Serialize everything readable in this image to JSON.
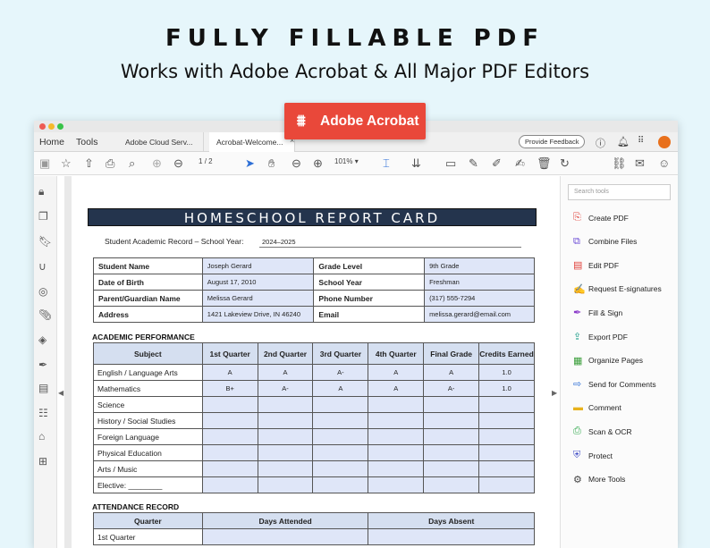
{
  "headline": "FULLY FILLABLE PDF",
  "subheadline": "Works with Adobe Acrobat & All Major PDF Editors",
  "badge": {
    "label": "Adobe Acrobat",
    "color": "#e9483a"
  },
  "tabbar": {
    "home": "Home",
    "tools": "Tools",
    "tab1": "Adobe Cloud Serv...",
    "tab2": "Acrobat-Welcome...",
    "feedback": "Provide Feedback"
  },
  "toolbar": {
    "page_current": "1",
    "page_sep": "/",
    "page_total": "2",
    "zoom": "101%"
  },
  "report": {
    "title": "HOMESCHOOL REPORT CARD",
    "school_year_label": "Student Academic Record – School Year:",
    "school_year": "2024–2025",
    "info": [
      {
        "label": "Student Name",
        "value": "Joseph Gerard",
        "label2": "Grade Level",
        "value2": "9th Grade"
      },
      {
        "label": "Date of Birth",
        "value": "August 17, 2010",
        "label2": "School Year",
        "value2": "Freshman"
      },
      {
        "label": "Parent/Guardian Name",
        "value": "Melissa Gerard",
        "label2": "Phone Number",
        "value2": "(317) 555-7294"
      },
      {
        "label": "Address",
        "value": "1421 Lakeview Drive, IN 46240",
        "label2": "Email",
        "value2": "melissa.gerard@email.com"
      }
    ],
    "academic_title": "ACADEMIC PERFORMANCE",
    "academic_headers": [
      "Subject",
      "1st Quarter",
      "2nd Quarter",
      "3rd Quarter",
      "4th Quarter",
      "Final Grade",
      "Credits Earned"
    ],
    "academic_rows": [
      [
        "English / Language Arts",
        "A",
        "A",
        "A-",
        "A",
        "A",
        "1.0"
      ],
      [
        "Mathematics",
        "B+",
        "A-",
        "A",
        "A",
        "A-",
        "1.0"
      ],
      [
        "Science",
        "",
        "",
        "",
        "",
        "",
        ""
      ],
      [
        "History / Social Studies",
        "",
        "",
        "",
        "",
        "",
        ""
      ],
      [
        "Foreign Language",
        "",
        "",
        "",
        "",
        "",
        ""
      ],
      [
        "Physical Education",
        "",
        "",
        "",
        "",
        "",
        ""
      ],
      [
        "Arts / Music",
        "",
        "",
        "",
        "",
        "",
        ""
      ],
      [
        "Elective: ________",
        "",
        "",
        "",
        "",
        "",
        ""
      ]
    ],
    "attendance_title": "ATTENDANCE RECORD",
    "attendance_headers": [
      "Quarter",
      "Days Attended",
      "Days Absent"
    ],
    "attendance_rows": [
      [
        "1st Quarter",
        "",
        ""
      ]
    ]
  },
  "right_panel": {
    "search_placeholder": "Search tools",
    "tools": [
      {
        "label": "Create PDF",
        "icon": "create-pdf-icon",
        "color": "#e0403a"
      },
      {
        "label": "Combine Files",
        "icon": "combine-files-icon",
        "color": "#6b4bd6"
      },
      {
        "label": "Edit PDF",
        "icon": "edit-pdf-icon",
        "color": "#e0403a"
      },
      {
        "label": "Request E-signatures",
        "icon": "e-signature-icon",
        "color": "#8a3ac9"
      },
      {
        "label": "Fill & Sign",
        "icon": "fill-sign-icon",
        "color": "#8a3ac9"
      },
      {
        "label": "Export PDF",
        "icon": "export-pdf-icon",
        "color": "#1f9e8a"
      },
      {
        "label": "Organize Pages",
        "icon": "organize-pages-icon",
        "color": "#3a9e3a"
      },
      {
        "label": "Send for Comments",
        "icon": "send-comments-icon",
        "color": "#2d6fd6"
      },
      {
        "label": "Comment",
        "icon": "comment-icon",
        "color": "#e8b21c"
      },
      {
        "label": "Scan & OCR",
        "icon": "scan-ocr-icon",
        "color": "#2ea84a"
      },
      {
        "label": "Protect",
        "icon": "protect-icon",
        "color": "#4a56c9"
      },
      {
        "label": "More Tools",
        "icon": "more-tools-icon",
        "color": "#444444"
      }
    ]
  }
}
